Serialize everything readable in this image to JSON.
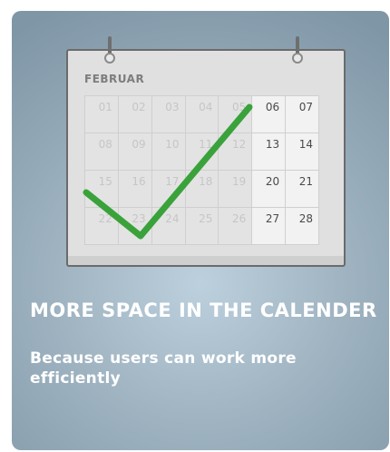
{
  "calendar": {
    "month": "FEBRUAR",
    "weeks": [
      [
        {
          "day": "01",
          "active": false
        },
        {
          "day": "02",
          "active": false
        },
        {
          "day": "03",
          "active": false
        },
        {
          "day": "04",
          "active": false
        },
        {
          "day": "05",
          "active": false
        },
        {
          "day": "06",
          "active": true
        },
        {
          "day": "07",
          "active": true
        }
      ],
      [
        {
          "day": "08",
          "active": false
        },
        {
          "day": "09",
          "active": false
        },
        {
          "day": "10",
          "active": false
        },
        {
          "day": "11",
          "active": false
        },
        {
          "day": "12",
          "active": false
        },
        {
          "day": "13",
          "active": true
        },
        {
          "day": "14",
          "active": true
        }
      ],
      [
        {
          "day": "15",
          "active": false
        },
        {
          "day": "16",
          "active": false
        },
        {
          "day": "17",
          "active": false
        },
        {
          "day": "18",
          "active": false
        },
        {
          "day": "19",
          "active": false
        },
        {
          "day": "20",
          "active": true
        },
        {
          "day": "21",
          "active": true
        }
      ],
      [
        {
          "day": "22",
          "active": false
        },
        {
          "day": "23",
          "active": false
        },
        {
          "day": "24",
          "active": false
        },
        {
          "day": "25",
          "active": false
        },
        {
          "day": "26",
          "active": false
        },
        {
          "day": "27",
          "active": true
        },
        {
          "day": "28",
          "active": true
        }
      ]
    ],
    "checkmark_color": "#3aa23a"
  },
  "headline": "MORE SPACE IN THE CALENDER",
  "description": "Because users can work more efficiently"
}
